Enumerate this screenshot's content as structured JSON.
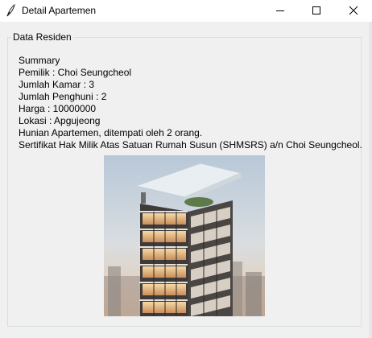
{
  "window": {
    "title": "Detail Apartemen",
    "icon": "tk-feather-icon",
    "controls": [
      "minimize-icon",
      "maximize-icon",
      "close-icon"
    ]
  },
  "group": {
    "legend": "Data Residen"
  },
  "details": {
    "lines": [
      "Summary",
      "Pemilik : Choi Seungcheol",
      "Jumlah Kamar : 3",
      "Jumlah Penghuni : 2",
      "Harga : 10000000",
      "Lokasi : Apgujeong",
      "Hunian Apartemen, ditempati oleh 2 orang.",
      "Sertifikat Hak Milik Atas Satuan Rumah Susun (SHMSRS) a/n Choi Seungcheol."
    ]
  },
  "image": {
    "subject": "apartment-building-photo"
  },
  "colors": {
    "titlebar": "#ffffff",
    "window_bg": "#f0f0f0",
    "frame_border": "#d5dfe5"
  }
}
